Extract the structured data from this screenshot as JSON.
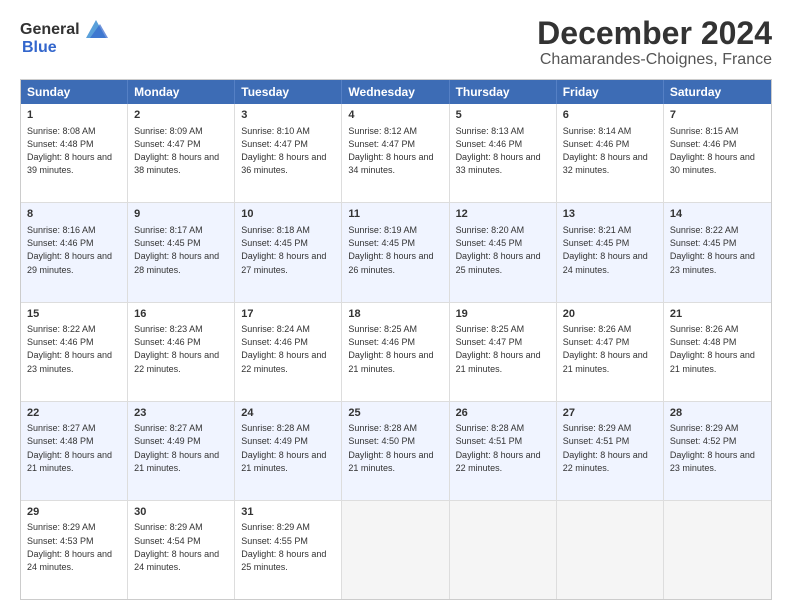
{
  "logo": {
    "general": "General",
    "blue": "Blue"
  },
  "title": "December 2024",
  "location": "Chamarandes-Choignes, France",
  "days": [
    "Sunday",
    "Monday",
    "Tuesday",
    "Wednesday",
    "Thursday",
    "Friday",
    "Saturday"
  ],
  "weeks": [
    [
      {
        "day": 1,
        "sunrise": "8:08 AM",
        "sunset": "4:48 PM",
        "daylight": "8 hours and 39 minutes."
      },
      {
        "day": 2,
        "sunrise": "8:09 AM",
        "sunset": "4:47 PM",
        "daylight": "8 hours and 38 minutes."
      },
      {
        "day": 3,
        "sunrise": "8:10 AM",
        "sunset": "4:47 PM",
        "daylight": "8 hours and 36 minutes."
      },
      {
        "day": 4,
        "sunrise": "8:12 AM",
        "sunset": "4:47 PM",
        "daylight": "8 hours and 34 minutes."
      },
      {
        "day": 5,
        "sunrise": "8:13 AM",
        "sunset": "4:46 PM",
        "daylight": "8 hours and 33 minutes."
      },
      {
        "day": 6,
        "sunrise": "8:14 AM",
        "sunset": "4:46 PM",
        "daylight": "8 hours and 32 minutes."
      },
      {
        "day": 7,
        "sunrise": "8:15 AM",
        "sunset": "4:46 PM",
        "daylight": "8 hours and 30 minutes."
      }
    ],
    [
      {
        "day": 8,
        "sunrise": "8:16 AM",
        "sunset": "4:46 PM",
        "daylight": "8 hours and 29 minutes."
      },
      {
        "day": 9,
        "sunrise": "8:17 AM",
        "sunset": "4:45 PM",
        "daylight": "8 hours and 28 minutes."
      },
      {
        "day": 10,
        "sunrise": "8:18 AM",
        "sunset": "4:45 PM",
        "daylight": "8 hours and 27 minutes."
      },
      {
        "day": 11,
        "sunrise": "8:19 AM",
        "sunset": "4:45 PM",
        "daylight": "8 hours and 26 minutes."
      },
      {
        "day": 12,
        "sunrise": "8:20 AM",
        "sunset": "4:45 PM",
        "daylight": "8 hours and 25 minutes."
      },
      {
        "day": 13,
        "sunrise": "8:21 AM",
        "sunset": "4:45 PM",
        "daylight": "8 hours and 24 minutes."
      },
      {
        "day": 14,
        "sunrise": "8:22 AM",
        "sunset": "4:45 PM",
        "daylight": "8 hours and 23 minutes."
      }
    ],
    [
      {
        "day": 15,
        "sunrise": "8:22 AM",
        "sunset": "4:46 PM",
        "daylight": "8 hours and 23 minutes."
      },
      {
        "day": 16,
        "sunrise": "8:23 AM",
        "sunset": "4:46 PM",
        "daylight": "8 hours and 22 minutes."
      },
      {
        "day": 17,
        "sunrise": "8:24 AM",
        "sunset": "4:46 PM",
        "daylight": "8 hours and 22 minutes."
      },
      {
        "day": 18,
        "sunrise": "8:25 AM",
        "sunset": "4:46 PM",
        "daylight": "8 hours and 21 minutes."
      },
      {
        "day": 19,
        "sunrise": "8:25 AM",
        "sunset": "4:47 PM",
        "daylight": "8 hours and 21 minutes."
      },
      {
        "day": 20,
        "sunrise": "8:26 AM",
        "sunset": "4:47 PM",
        "daylight": "8 hours and 21 minutes."
      },
      {
        "day": 21,
        "sunrise": "8:26 AM",
        "sunset": "4:48 PM",
        "daylight": "8 hours and 21 minutes."
      }
    ],
    [
      {
        "day": 22,
        "sunrise": "8:27 AM",
        "sunset": "4:48 PM",
        "daylight": "8 hours and 21 minutes."
      },
      {
        "day": 23,
        "sunrise": "8:27 AM",
        "sunset": "4:49 PM",
        "daylight": "8 hours and 21 minutes."
      },
      {
        "day": 24,
        "sunrise": "8:28 AM",
        "sunset": "4:49 PM",
        "daylight": "8 hours and 21 minutes."
      },
      {
        "day": 25,
        "sunrise": "8:28 AM",
        "sunset": "4:50 PM",
        "daylight": "8 hours and 21 minutes."
      },
      {
        "day": 26,
        "sunrise": "8:28 AM",
        "sunset": "4:51 PM",
        "daylight": "8 hours and 22 minutes."
      },
      {
        "day": 27,
        "sunrise": "8:29 AM",
        "sunset": "4:51 PM",
        "daylight": "8 hours and 22 minutes."
      },
      {
        "day": 28,
        "sunrise": "8:29 AM",
        "sunset": "4:52 PM",
        "daylight": "8 hours and 23 minutes."
      }
    ],
    [
      {
        "day": 29,
        "sunrise": "8:29 AM",
        "sunset": "4:53 PM",
        "daylight": "8 hours and 24 minutes."
      },
      {
        "day": 30,
        "sunrise": "8:29 AM",
        "sunset": "4:54 PM",
        "daylight": "8 hours and 24 minutes."
      },
      {
        "day": 31,
        "sunrise": "8:29 AM",
        "sunset": "4:55 PM",
        "daylight": "8 hours and 25 minutes."
      },
      null,
      null,
      null,
      null
    ]
  ]
}
